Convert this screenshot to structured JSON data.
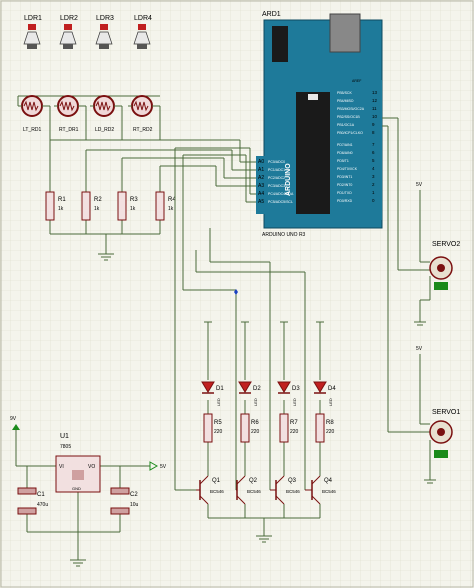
{
  "ldrs": [
    {
      "ref": "LDR1",
      "name": "LT_RD1"
    },
    {
      "ref": "LDR2",
      "name": "RT_DR1"
    },
    {
      "ref": "LDR3",
      "name": "LD_RD2"
    },
    {
      "ref": "LDR4",
      "name": "RT_RD2"
    }
  ],
  "resistors": [
    {
      "ref": "R1",
      "value": "1k"
    },
    {
      "ref": "R2",
      "value": "1k"
    },
    {
      "ref": "R3",
      "value": "1k"
    },
    {
      "ref": "R4",
      "value": "1k"
    }
  ],
  "arduino": {
    "ref": "ARD1",
    "model": "ARDUINO UNO R3",
    "brand": "ARDUINO",
    "analog_pins": [
      "A0",
      "A1",
      "A2",
      "A3",
      "A4",
      "A5"
    ],
    "analog_labels": [
      "PC0/ADC0",
      "PC1/ADC1",
      "PC2/ADC2",
      "PC3/ADC3",
      "PC4/ADC4/SDA",
      "PC5/ADC5/SCL"
    ],
    "digital_pins": [
      "13",
      "12",
      "11",
      "10",
      "9",
      "8",
      "7",
      "6",
      "5",
      "4",
      "3",
      "2",
      "1",
      "0"
    ],
    "digital_labels": [
      "PB5/SCK",
      "PB4/MISO",
      "PB3/MOSI/OC2A",
      "PB2/SS/OC1B",
      "PB1/OC1A",
      "PB0/ICP1/CLKO",
      "PD7/AIN1",
      "PD6/AIN0",
      "PD5/T1",
      "PD4/T0/XCK",
      "PD3/INT1",
      "PD2/INT0",
      "PD1/TXD",
      "PD0/RXD"
    ],
    "aref": "AREF"
  },
  "servos": [
    {
      "ref": "SERVO2",
      "supply": "5V"
    },
    {
      "ref": "SERVO1",
      "supply": "5V"
    }
  ],
  "leds": [
    {
      "ref": "D1",
      "type": "LED"
    },
    {
      "ref": "D2",
      "type": "LED"
    },
    {
      "ref": "D3",
      "type": "LED"
    },
    {
      "ref": "D4",
      "type": "LED"
    }
  ],
  "led_resistors": [
    {
      "ref": "R5",
      "value": "220"
    },
    {
      "ref": "R6",
      "value": "220"
    },
    {
      "ref": "R7",
      "value": "220"
    },
    {
      "ref": "R8",
      "value": "220"
    }
  ],
  "transistors": [
    {
      "ref": "Q1",
      "part": "BC546"
    },
    {
      "ref": "Q2",
      "part": "BC546"
    },
    {
      "ref": "Q3",
      "part": "BC546"
    },
    {
      "ref": "Q4",
      "part": "BC546"
    }
  ],
  "regulator": {
    "ref": "U1",
    "part": "7805",
    "vi": "VI",
    "vo": "VO",
    "gnd": "GND"
  },
  "caps": [
    {
      "ref": "C1",
      "value": "470u"
    },
    {
      "ref": "C2",
      "value": "10u"
    }
  ],
  "supply": {
    "in": "9V",
    "out": "5V"
  },
  "colors": {
    "wire": "#4a6a3a",
    "component": "#a01818",
    "grid": "#d8d8c8",
    "board": "#1e7a9a",
    "background": "#f4f4ec",
    "power": "#1a8a1a"
  }
}
